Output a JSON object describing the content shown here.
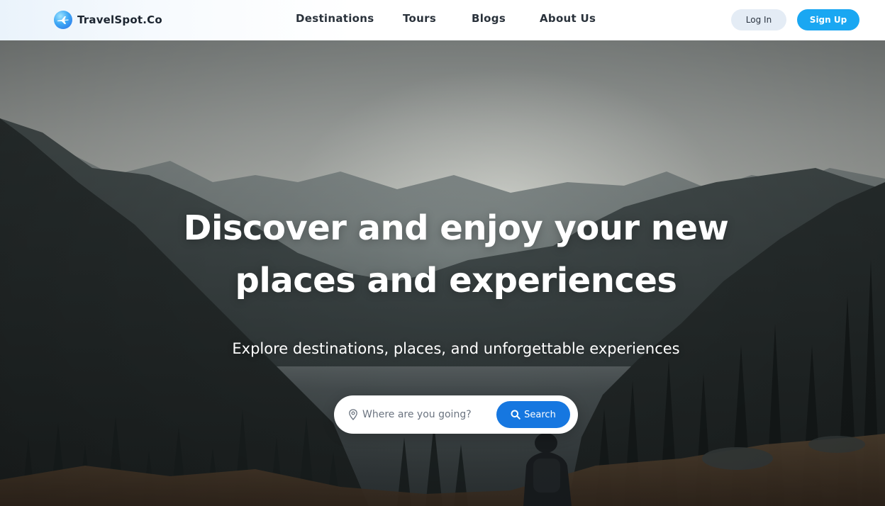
{
  "brand": {
    "name": "TravelSpot.Co",
    "logo_icon": "plane-icon"
  },
  "nav": {
    "links": [
      {
        "label": "Destinations"
      },
      {
        "label": "Tours"
      },
      {
        "label": "Blogs"
      },
      {
        "label": "About Us"
      }
    ]
  },
  "auth": {
    "login_label": "Log In",
    "signup_label": "Sign Up"
  },
  "hero": {
    "title_line1": "Discover and enjoy your new",
    "title_line2": "places and experiences",
    "subtitle": "Explore destinations, places, and unforgettable experiences",
    "background_image": "mountain-valley-hiker-photo"
  },
  "search": {
    "placeholder": "Where are you going?",
    "value": "",
    "button_label": "Search",
    "location_icon": "map-pin-icon",
    "button_icon": "search-icon"
  },
  "colors": {
    "primary": "#1677e0",
    "signup": "#1aa7f2",
    "login_bg": "#e4ecf5",
    "text_dark": "#2a323b"
  }
}
